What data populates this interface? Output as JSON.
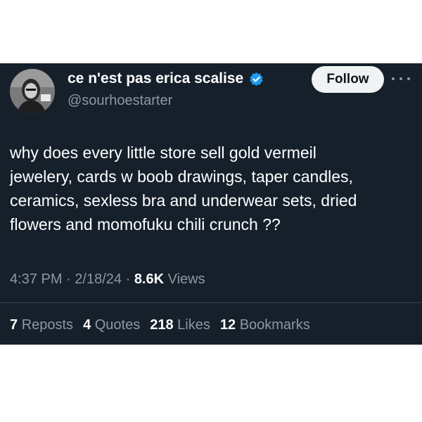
{
  "tweet": {
    "author": {
      "display_name": "ce n'est pas erica scalise",
      "handle": "@sourhoestarter",
      "verified": true,
      "avatar_icon": "profile-photo"
    },
    "follow_label": "Follow",
    "more_icon": "more-horizontal-icon",
    "text_lines": [
      "why does every little store sell gold vermeil",
      "jewelery, cards w boob drawings, taper candles,",
      "ceramics, sexless bra and underwear sets, dried",
      "flowers and momofuku chili crunch ??"
    ],
    "time": "4:37 PM",
    "date": "2/18/24",
    "separator": "·",
    "views_count": "8.6K",
    "views_label": "Views",
    "stats": [
      {
        "count": "7",
        "label": "Reposts"
      },
      {
        "count": "4",
        "label": "Quotes"
      },
      {
        "count": "218",
        "label": "Likes"
      },
      {
        "count": "12",
        "label": "Bookmarks"
      }
    ]
  },
  "colors": {
    "card_background": "#15202b",
    "page_background": "#ffffff",
    "secondary_text": "#8b98a5",
    "verified_badge": "#1d9bf0",
    "follow_button": "#eff3f4"
  }
}
